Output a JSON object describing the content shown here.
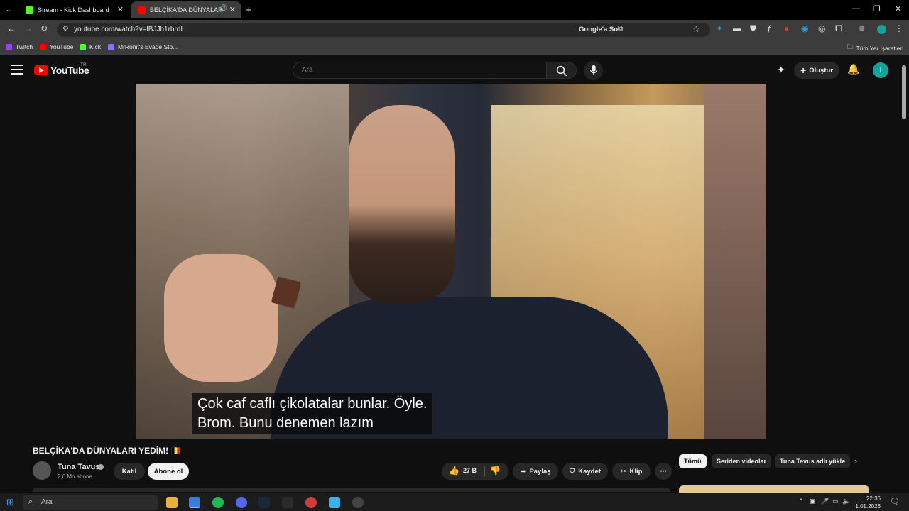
{
  "browser": {
    "tabs": [
      {
        "title": "Stream - Kick Dashboard",
        "favicon_color": "#53fc18"
      },
      {
        "title": "BELÇİKA'DA DÜNYALARI YE",
        "favicon_color": "#ff0000"
      }
    ],
    "url": "youtube.com/watch?v=lBJJh1rbrdI",
    "google_sor": "Google'a Sor",
    "bookmarks": [
      {
        "label": "Twitch",
        "color": "#9146ff"
      },
      {
        "label": "YouTube",
        "color": "#ff0000"
      },
      {
        "label": "Kick",
        "color": "#53fc18"
      },
      {
        "label": "MrRonit's Evade Sto...",
        "color": "#7a7aff"
      }
    ],
    "all_bookmarks": "Tüm Yer İşaretleri"
  },
  "youtube": {
    "logo": "YouTube",
    "region": "TR",
    "search_placeholder": "Ara",
    "create_label": "Oluştur",
    "avatar_letter": "I"
  },
  "video": {
    "subtitle_lines": [
      "Çok caf caflı çikolatalar bunlar. Öyle.",
      "Brom. Bunu denemen lazım"
    ],
    "title": "BELÇİKA'DA DÜNYALARI YEDİM! 🇧🇪"
  },
  "channel": {
    "name": "Tuna Tavus",
    "subscribers": "2,6 Mn abone",
    "join_label": "Katıl",
    "subscribe_label": "Abone ol"
  },
  "actions": {
    "like_count": "27 B",
    "share": "Paylaş",
    "save": "Kaydet",
    "clip": "Klip"
  },
  "chips": [
    "Tümü",
    "Seriden videolar",
    "Tuna Tavus adlı yükle"
  ],
  "taskbar": {
    "search_placeholder": "Ara",
    "time": "22:36",
    "date": "1.01.2026"
  }
}
